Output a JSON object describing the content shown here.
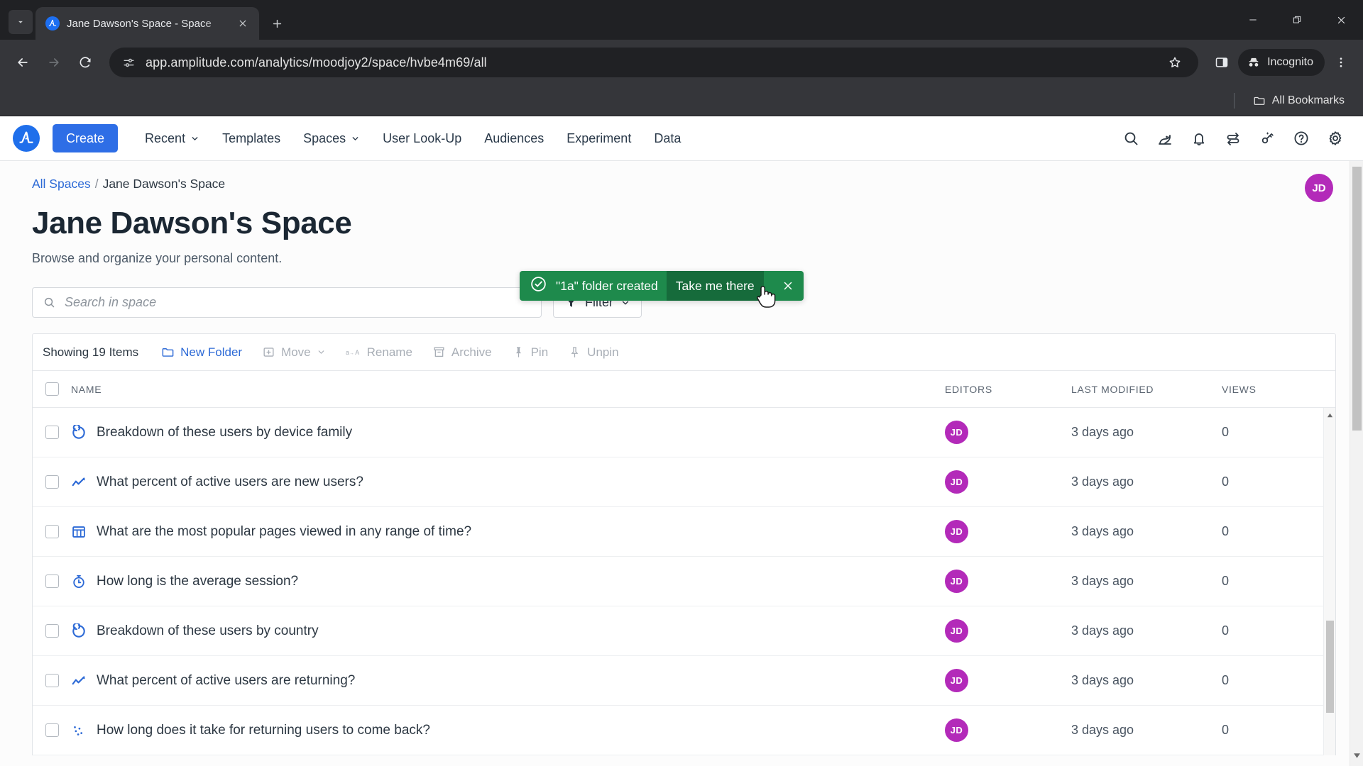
{
  "browser": {
    "tab": {
      "title": "Jane Dawson's Space - Space",
      "favicon": "amplitude-logo-icon"
    },
    "new_tab_label": "+",
    "url": "app.amplitude.com/analytics/moodjoy2/space/hvbe4m69/all",
    "profile_label": "Incognito",
    "bookmarks_label": "All Bookmarks",
    "window_controls": {
      "minimize": "minimize-icon",
      "maximize": "restore-icon",
      "close": "close-icon"
    }
  },
  "app": {
    "create_label": "Create",
    "nav_items": [
      {
        "label": "Recent",
        "caret": true
      },
      {
        "label": "Templates",
        "caret": false
      },
      {
        "label": "Spaces",
        "caret": true
      },
      {
        "label": "User Look-Up",
        "caret": false
      },
      {
        "label": "Audiences",
        "caret": false
      },
      {
        "label": "Experiment",
        "caret": false
      },
      {
        "label": "Data",
        "caret": false
      }
    ],
    "nav_icons": [
      "search-icon",
      "rocket-icon",
      "bell-icon",
      "swap-icon",
      "magic-key-icon",
      "help-icon",
      "gear-icon"
    ],
    "user_initials": "JD"
  },
  "toast": {
    "status_icon": "check-circle-icon",
    "message": "\"1a\" folder created",
    "action_label": "Take me there",
    "close_icon": "close-icon"
  },
  "breadcrumb": {
    "root": "All Spaces",
    "separator": "/",
    "current": "Jane Dawson's Space"
  },
  "header": {
    "title": "Jane Dawson's Space",
    "subtitle": "Browse and organize your personal content."
  },
  "search": {
    "placeholder": "Search in space",
    "value": ""
  },
  "filter": {
    "label": "Filter"
  },
  "toolbar": {
    "showing": "Showing 19 Items",
    "actions": [
      {
        "label": "New Folder",
        "icon": "folder-icon",
        "state": "active",
        "caret": false
      },
      {
        "label": "Move",
        "icon": "move-icon",
        "state": "disabled",
        "caret": true
      },
      {
        "label": "Rename",
        "icon": "rename-icon",
        "state": "disabled",
        "caret": false
      },
      {
        "label": "Archive",
        "icon": "archive-icon",
        "state": "disabled",
        "caret": false
      },
      {
        "label": "Pin",
        "icon": "pin-icon",
        "state": "disabled",
        "caret": false
      },
      {
        "label": "Unpin",
        "icon": "unpin-icon",
        "state": "disabled",
        "caret": false
      }
    ]
  },
  "table": {
    "columns": {
      "name": "NAME",
      "editors": "EDITORS",
      "modified": "LAST MODIFIED",
      "views": "VIEWS"
    },
    "rows": [
      {
        "icon": "donut-chart-icon",
        "name": "Breakdown of these users by device family",
        "editor": "JD",
        "modified": "3 days ago",
        "views": "0"
      },
      {
        "icon": "line-chart-icon",
        "name": "What percent of active users are new users?",
        "editor": "JD",
        "modified": "3 days ago",
        "views": "0"
      },
      {
        "icon": "table-icon",
        "name": "What are the most popular pages viewed in any range of time?",
        "editor": "JD",
        "modified": "3 days ago",
        "views": "0"
      },
      {
        "icon": "stopwatch-icon",
        "name": "How long is the average session?",
        "editor": "JD",
        "modified": "3 days ago",
        "views": "0"
      },
      {
        "icon": "donut-chart-icon",
        "name": "Breakdown of these users by country",
        "editor": "JD",
        "modified": "3 days ago",
        "views": "0"
      },
      {
        "icon": "line-chart-icon",
        "name": "What percent of active users are returning?",
        "editor": "JD",
        "modified": "3 days ago",
        "views": "0"
      },
      {
        "icon": "scatter-icon",
        "name": "How long does it take for returning users to come back?",
        "editor": "JD",
        "modified": "3 days ago",
        "views": "0"
      }
    ]
  },
  "colors": {
    "brand_blue": "#2e6ee6",
    "toast_green": "#1e8a4c",
    "toast_green_dark": "#166b3b",
    "avatar_purple": "#b32ab9",
    "chrome_dark": "#202124",
    "chrome_toolbar": "#35363a"
  }
}
